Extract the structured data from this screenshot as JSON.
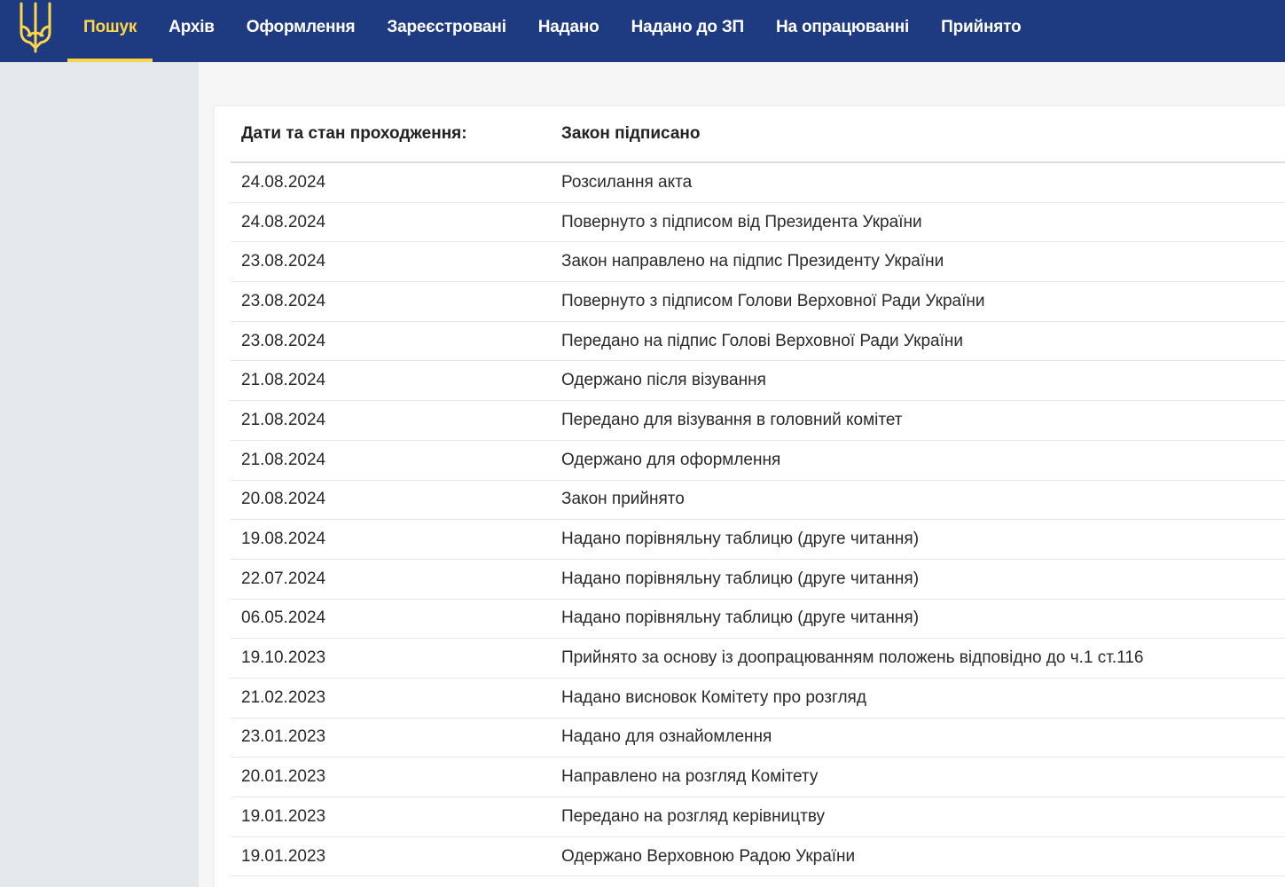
{
  "nav": {
    "items": [
      {
        "label": "Пошук",
        "active": true
      },
      {
        "label": "Архів"
      },
      {
        "label": "Оформлення"
      },
      {
        "label": "Зареєстровані"
      },
      {
        "label": "Надано"
      },
      {
        "label": "Надано до ЗП"
      },
      {
        "label": "На опрацюванні"
      },
      {
        "label": "Прийнято"
      }
    ]
  },
  "colors": {
    "header_bg": "#1e3a80",
    "accent": "#ffd54a"
  },
  "table": {
    "header": {
      "col1": "Дати та стан проходження:",
      "col2": "Закон підписано"
    },
    "rows": [
      {
        "date": "24.08.2024",
        "status": "Розсилання акта"
      },
      {
        "date": "24.08.2024",
        "status": "Повернуто з підписом від Президента України"
      },
      {
        "date": "23.08.2024",
        "status": "Закон направлено на підпис Президенту України"
      },
      {
        "date": "23.08.2024",
        "status": "Повернуто з підписом Голови Верховної Ради України"
      },
      {
        "date": "23.08.2024",
        "status": "Передано на підпис Голові Верховної Ради України"
      },
      {
        "date": "21.08.2024",
        "status": "Одержано після візування"
      },
      {
        "date": "21.08.2024",
        "status": "Передано для візування в головний комітет"
      },
      {
        "date": "21.08.2024",
        "status": "Одержано для оформлення"
      },
      {
        "date": "20.08.2024",
        "status": "Закон прийнято"
      },
      {
        "date": "19.08.2024",
        "status": "Надано порівняльну таблицю (друге читання)"
      },
      {
        "date": "22.07.2024",
        "status": "Надано порівняльну таблицю (друге читання)"
      },
      {
        "date": "06.05.2024",
        "status": "Надано порівняльну таблицю (друге читання)"
      },
      {
        "date": "19.10.2023",
        "status": "Прийнято за основу із доопрацюванням положень відповідно до ч.1 ст.116"
      },
      {
        "date": "21.02.2023",
        "status": "Надано висновок Комітету про розгляд"
      },
      {
        "date": "23.01.2023",
        "status": "Надано для ознайомлення"
      },
      {
        "date": "20.01.2023",
        "status": "Направлено на розгляд Комітету"
      },
      {
        "date": "19.01.2023",
        "status": "Передано на розгляд керівництву"
      },
      {
        "date": "19.01.2023",
        "status": "Одержано Верховною Радою України"
      }
    ]
  }
}
